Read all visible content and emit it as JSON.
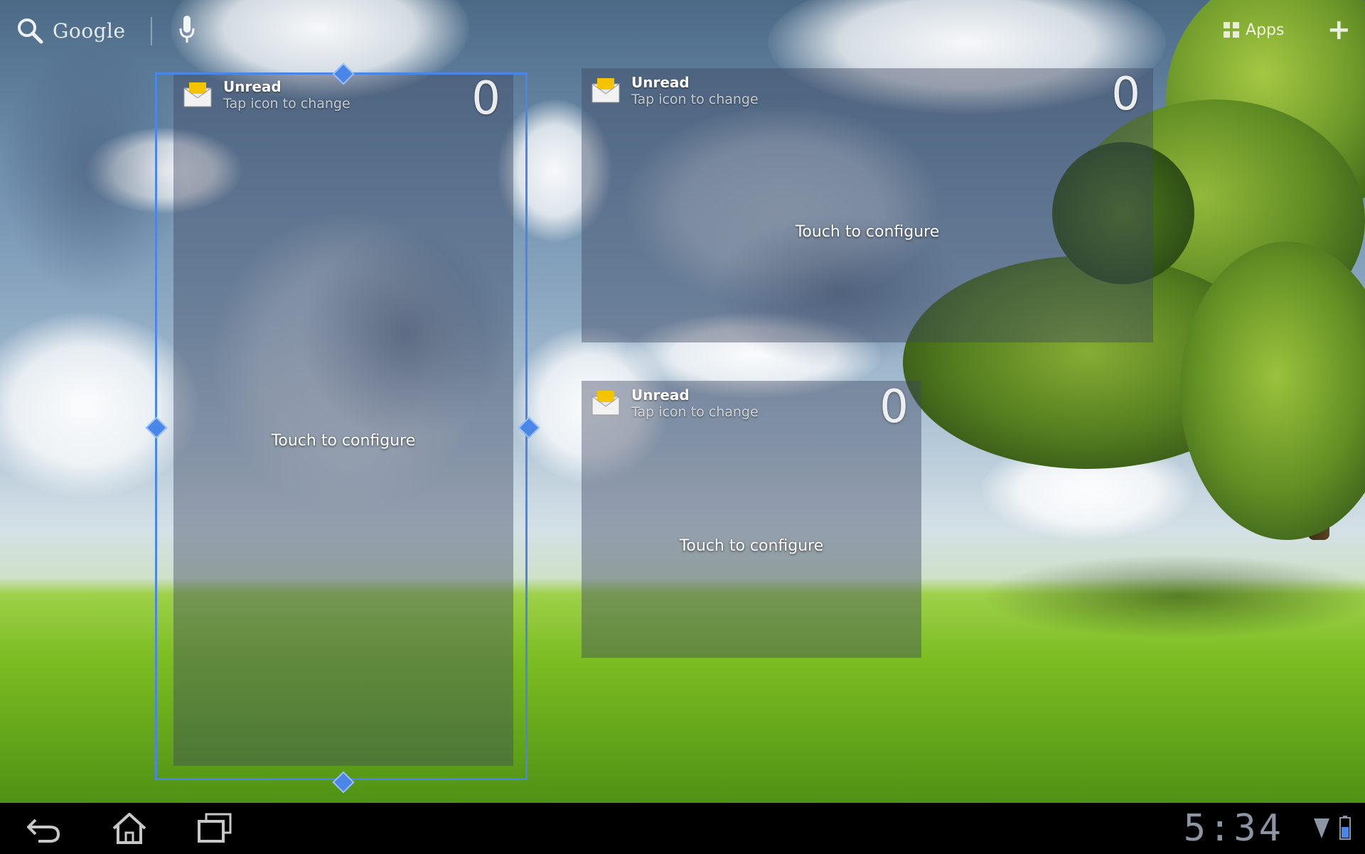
{
  "top_bar": {
    "search_brand": "Google",
    "apps_label": "Apps",
    "add_label": "+"
  },
  "widgets": [
    {
      "title": "Unread",
      "subtitle": "Tap icon to change",
      "count": "0",
      "configure_text": "Touch to configure"
    },
    {
      "title": "Unread",
      "subtitle": "Tap icon to change",
      "count": "0",
      "configure_text": "Touch to configure"
    },
    {
      "title": "Unread",
      "subtitle": "Tap icon to change",
      "count": "0",
      "configure_text": "Touch to configure"
    }
  ],
  "navbar": {
    "clock": "5:34"
  },
  "colors": {
    "resize_frame": "#4a86e8",
    "navbar_bg": "#000000",
    "clock_text": "#8b95a3"
  },
  "icons": {
    "search": "search-icon",
    "mic": "microphone-icon",
    "apps": "apps-grid-icon",
    "envelope": "envelope-icon",
    "back": "back-icon",
    "home": "home-icon",
    "recent": "recent-apps-icon",
    "wifi": "wifi-icon",
    "battery": "battery-icon"
  }
}
